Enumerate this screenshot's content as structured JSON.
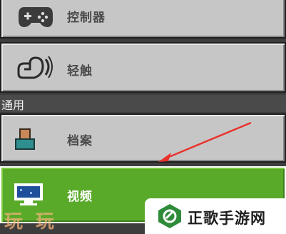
{
  "menu": {
    "items": [
      {
        "label": "控制器",
        "icon": "gamepad-icon"
      },
      {
        "label": "轻触",
        "icon": "touch-hand-icon"
      }
    ],
    "section_header": "通用",
    "general_items": [
      {
        "label": "档案",
        "icon": "profile-icon"
      },
      {
        "label": "视频",
        "icon": "monitor-icon",
        "selected": true
      }
    ]
  },
  "watermarks": {
    "left_text": "玩玩",
    "right_text": "正歌手游网"
  },
  "colors": {
    "button_bg": "#c6c6c6",
    "selected_bg": "#5aaa2a",
    "arrow": "#e8322c"
  }
}
